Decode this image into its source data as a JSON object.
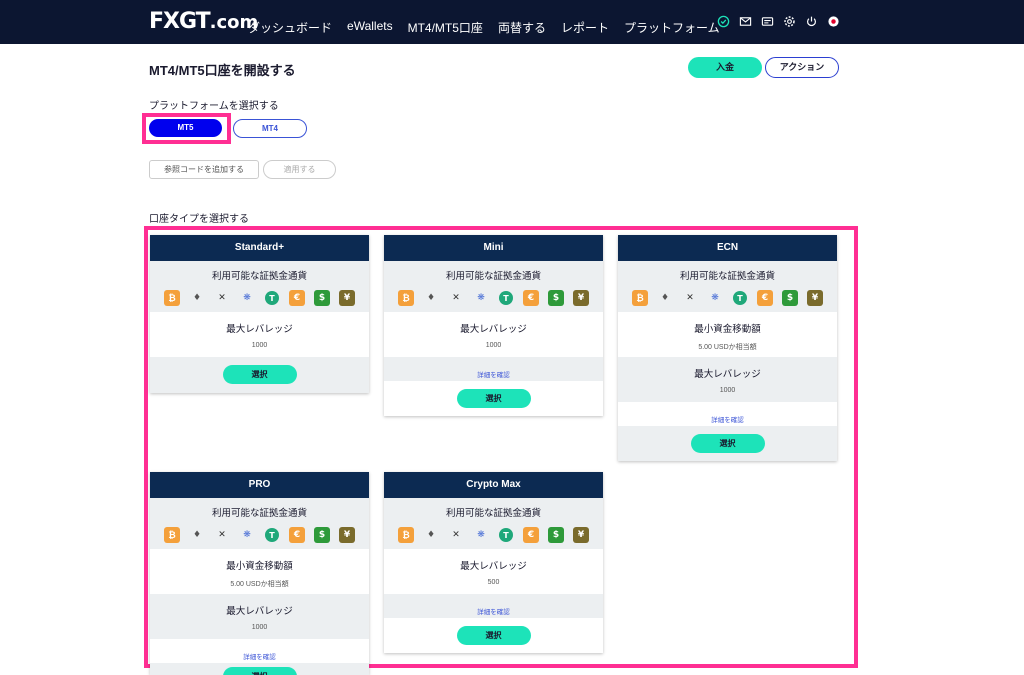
{
  "header": {
    "logo": "FXGT",
    "logo_suffix": ".com",
    "nav": [
      "ダッシュボード",
      "eWallets",
      "MT4/MT5口座",
      "両替する",
      "レポート",
      "プラットフォーム"
    ],
    "icons": [
      "check-circle-icon",
      "mail-icon",
      "inbox-icon",
      "gear-icon",
      "power-icon",
      "flag-icon"
    ]
  },
  "page": {
    "title": "MT4/MT5口座を開設する",
    "deposit_label": "入金",
    "action_label": "アクション",
    "platform_label": "プラットフォームを選択する",
    "mt5_label": "MT5",
    "mt4_label": "MT4",
    "ref_code_label": "参照コードを追加する",
    "apply_label": "適用する",
    "account_type_label": "口座タイプを選択する"
  },
  "card_common": {
    "currencies_title": "利用可能な証拠金通貨",
    "currencies": [
      "BTC",
      "ETH",
      "XRP",
      "ADA",
      "USDT",
      "EUR",
      "USD",
      "JPY"
    ],
    "leverage_title": "最大レバレッジ",
    "min_transfer_title": "最小資金移動額",
    "detail_link": "詳細を確認",
    "select_label": "選択"
  },
  "cards": [
    {
      "name": "Standard+",
      "leverage": "1000"
    },
    {
      "name": "Mini",
      "leverage": "1000"
    },
    {
      "name": "ECN",
      "min_transfer": "5.00 USDか相当額",
      "leverage": "1000"
    },
    {
      "name": "PRO",
      "min_transfer": "5.00 USDか相当額",
      "leverage": "1000"
    },
    {
      "name": "Crypto Max",
      "leverage": "500"
    }
  ],
  "colors": {
    "header_bg": "#0c1631",
    "card_head_bg": "#0c2a52",
    "accent_teal": "#1de3b9",
    "mt5_blue": "#0000ee",
    "highlight_pink": "#ff2e93"
  }
}
